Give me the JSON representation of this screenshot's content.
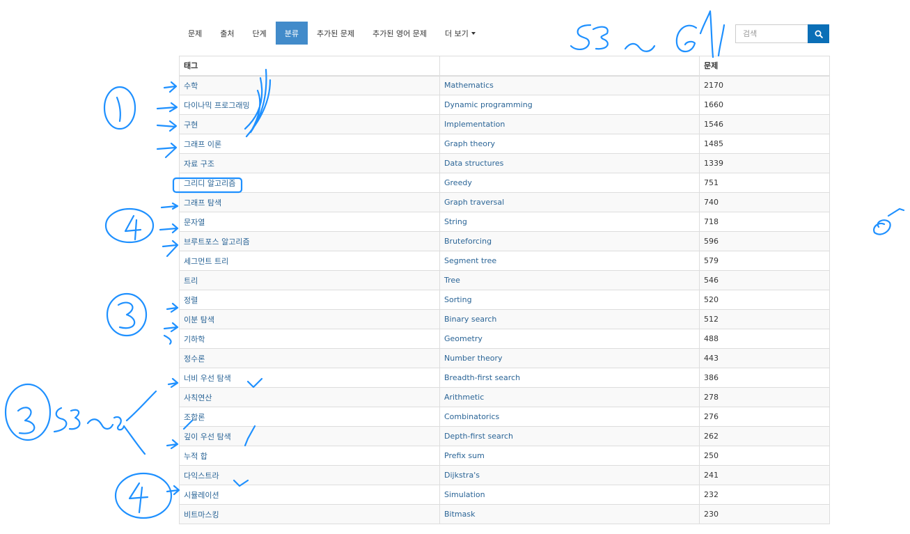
{
  "nav": {
    "items": [
      {
        "label": "문제"
      },
      {
        "label": "출처"
      },
      {
        "label": "단계"
      },
      {
        "label": "분류",
        "active": true
      },
      {
        "label": "추가된 문제"
      },
      {
        "label": "추가된 영어 문제"
      },
      {
        "label": "더 보기"
      }
    ]
  },
  "search": {
    "placeholder": "검색"
  },
  "table": {
    "headers": [
      "태그",
      "",
      "문제"
    ],
    "rows": [
      {
        "ko": "수학",
        "en": "Mathematics",
        "count": "2170"
      },
      {
        "ko": "다이나믹 프로그래밍",
        "en": "Dynamic programming",
        "count": "1660"
      },
      {
        "ko": "구현",
        "en": "Implementation",
        "count": "1546"
      },
      {
        "ko": "그래프 이론",
        "en": "Graph theory",
        "count": "1485"
      },
      {
        "ko": "자료 구조",
        "en": "Data structures",
        "count": "1339"
      },
      {
        "ko": "그리디 알고리즘",
        "en": "Greedy",
        "count": "751"
      },
      {
        "ko": "그래프 탐색",
        "en": "Graph traversal",
        "count": "740"
      },
      {
        "ko": "문자열",
        "en": "String",
        "count": "718"
      },
      {
        "ko": "브루트포스 알고리즘",
        "en": "Bruteforcing",
        "count": "596"
      },
      {
        "ko": "세그먼트 트리",
        "en": "Segment tree",
        "count": "579"
      },
      {
        "ko": "트리",
        "en": "Tree",
        "count": "546"
      },
      {
        "ko": "정렬",
        "en": "Sorting",
        "count": "520"
      },
      {
        "ko": "이분 탐색",
        "en": "Binary search",
        "count": "512"
      },
      {
        "ko": "기하학",
        "en": "Geometry",
        "count": "488"
      },
      {
        "ko": "정수론",
        "en": "Number theory",
        "count": "443"
      },
      {
        "ko": "너비 우선 탐색",
        "en": "Breadth-first search",
        "count": "386"
      },
      {
        "ko": "사칙연산",
        "en": "Arithmetic",
        "count": "278"
      },
      {
        "ko": "조합론",
        "en": "Combinatorics",
        "count": "276"
      },
      {
        "ko": "깊이 우선 탐색",
        "en": "Depth-first search",
        "count": "262"
      },
      {
        "ko": "누적 합",
        "en": "Prefix sum",
        "count": "250"
      },
      {
        "ko": "다익스트라",
        "en": "Dijkstra's",
        "count": "241"
      },
      {
        "ko": "시뮬레이션",
        "en": "Simulation",
        "count": "232"
      },
      {
        "ko": "비트마스킹",
        "en": "Bitmask",
        "count": "230"
      }
    ]
  },
  "colors": {
    "nav_active_bg": "#428bca",
    "search_button": "#0b6fb7",
    "link": "#2a6496",
    "annotation_ink": "#1e90ff"
  },
  "icons": {
    "search_button": "search-icon",
    "more_dropdown": "caret-down-icon"
  }
}
